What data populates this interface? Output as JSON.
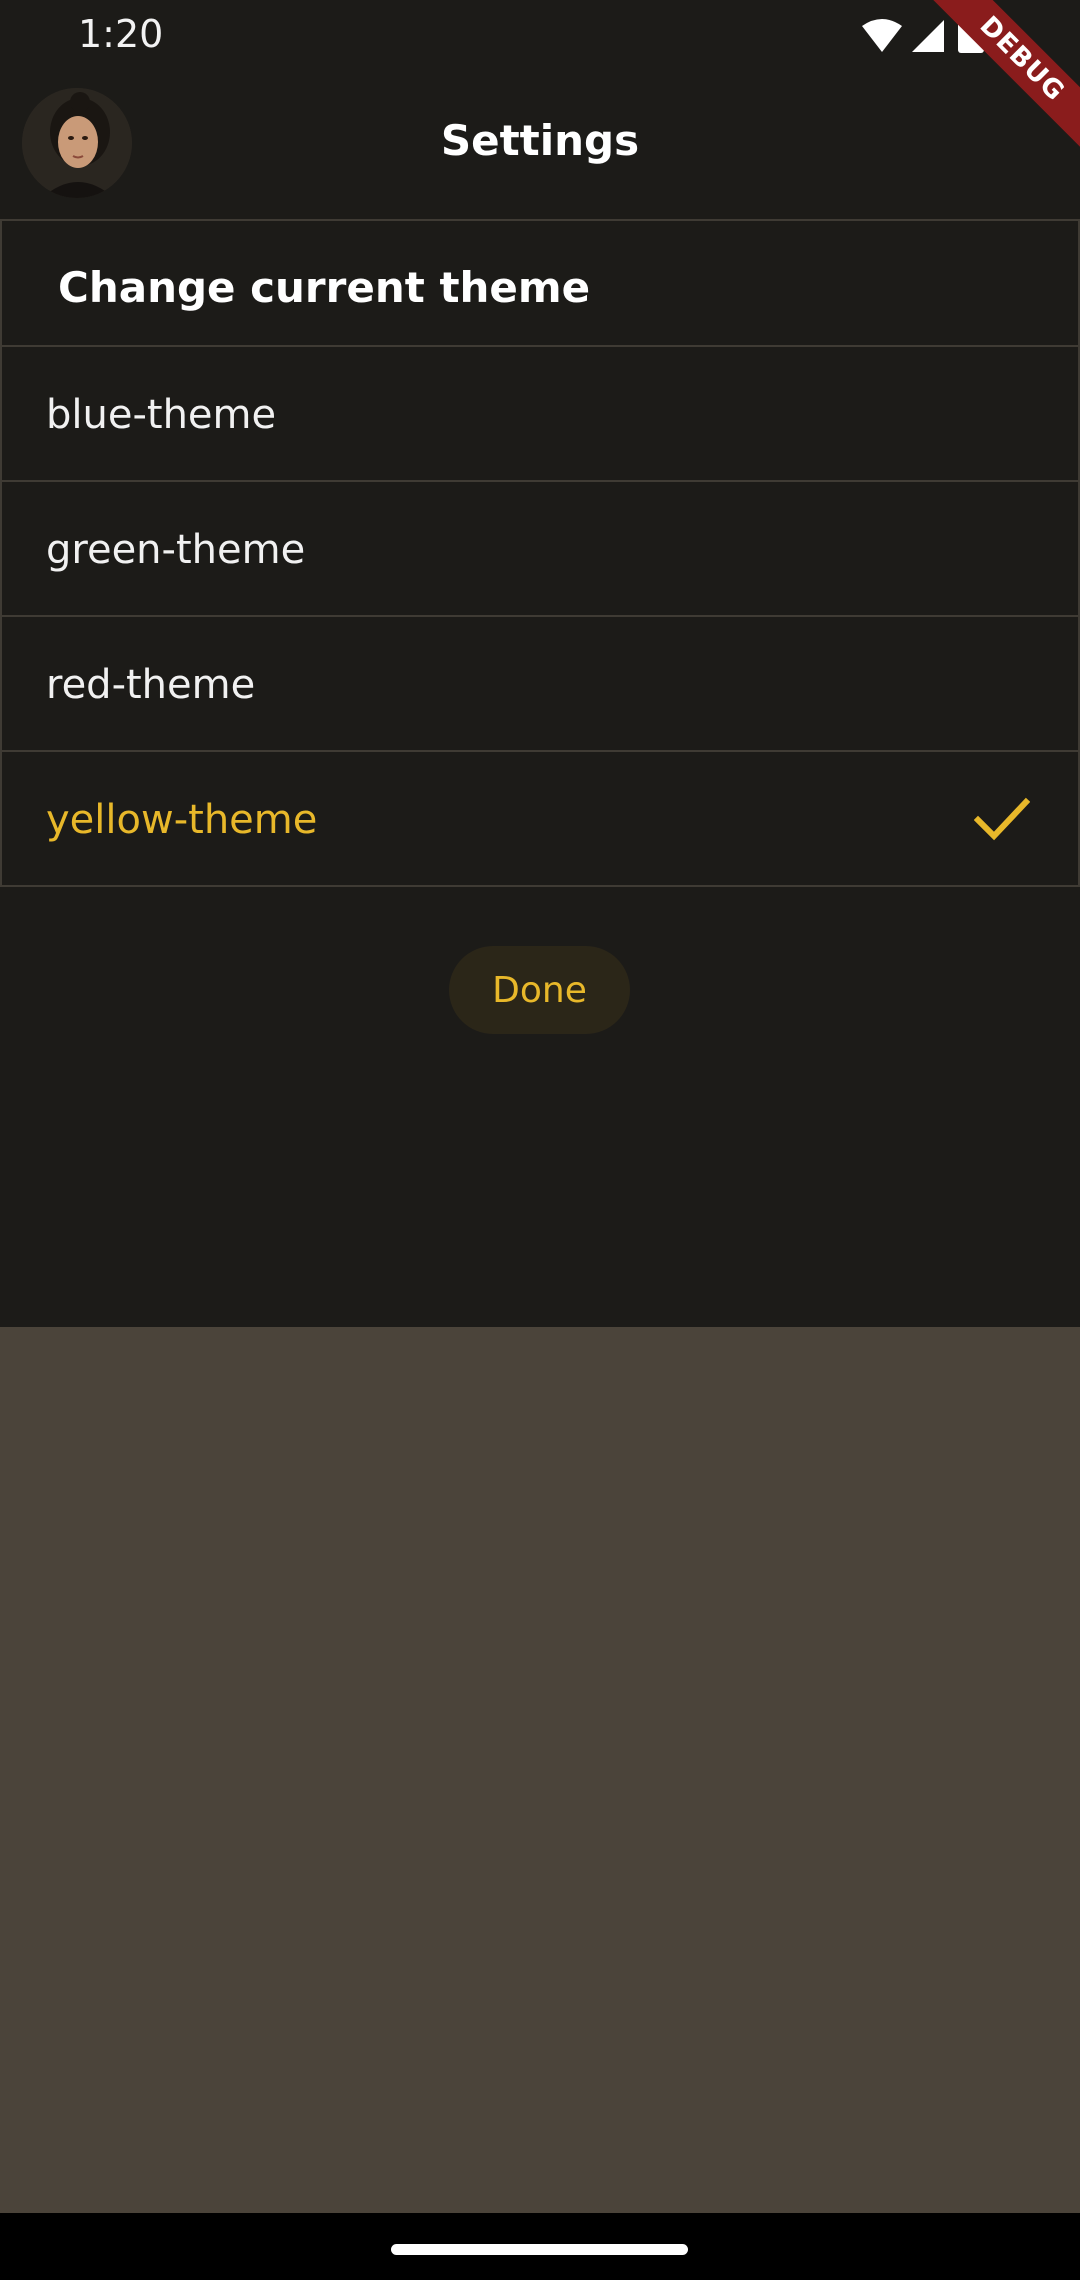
{
  "status_bar": {
    "time": "1:20",
    "icons": [
      "wifi-icon",
      "signal-icon",
      "battery-icon"
    ]
  },
  "debug_banner": {
    "label": "DEBUG"
  },
  "app_bar": {
    "title": "Settings",
    "avatar": "user-avatar"
  },
  "theme_list": {
    "header": "Change current theme",
    "items": [
      {
        "label": "blue-theme",
        "selected": false
      },
      {
        "label": "green-theme",
        "selected": false
      },
      {
        "label": "red-theme",
        "selected": false
      },
      {
        "label": "yellow-theme",
        "selected": true
      }
    ]
  },
  "actions": {
    "done_label": "Done"
  },
  "colors": {
    "sheet_background": "#1c1b18",
    "scrim_background": "#4b443a",
    "accent": "#e8b82a",
    "divider": "#3f3b34",
    "debug_ribbon": "#8a1c1c"
  }
}
